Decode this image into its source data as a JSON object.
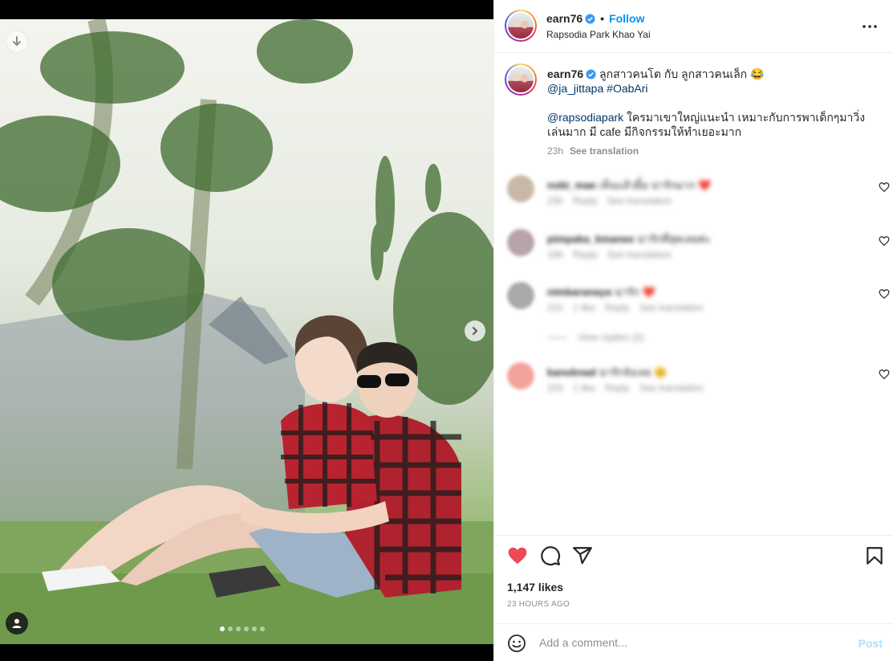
{
  "post": {
    "username": "earn76",
    "follow_label": "Follow",
    "separator": "•",
    "location": "Rapsodia Park Khao Yai"
  },
  "caption": {
    "username": "earn76",
    "line1": "ลูกสาวคนโต กับ ลูกสาวคนเล็ก 😂",
    "mention1": "@ja_jittapa",
    "hashtag": "#OabAri",
    "mention2": "@rapsodiapark",
    "body": "ใครมาเขาใหญ่แนะนำ เหมาะกับการพาเด็กๆมาวิ่งเล่นมาก มี cafe มีกิจกรรมให้ทำเยอะมาก",
    "age": "23h",
    "see_translation": "See translation"
  },
  "comments": [
    {
      "author": "nobi_mae",
      "text": "เห็นแล้วยิ้ม น่ารักมาก ❤️",
      "age": "23h",
      "reply": "Reply",
      "translate": "See translation",
      "avatar_color": "#c9b8a6"
    },
    {
      "author": "pimpaka_kmanee",
      "text": "น่ารักที่สุดเลยค่ะ",
      "age": "19h",
      "reply": "Reply",
      "translate": "See translation",
      "avatar_color": "#b7a3a8"
    },
    {
      "author": "nimbaranaya",
      "text": "น่ารัก ❤️",
      "age": "21h",
      "likes": "1 like",
      "reply": "Reply",
      "translate": "See translation",
      "avatar_color": "#a9a9a9"
    },
    {
      "author": "kanoknad",
      "text": "น่ารักจังเลย 😊",
      "age": "22h",
      "likes": "1 like",
      "reply": "Reply",
      "translate": "See translation",
      "avatar_color": "#f4a39a"
    }
  ],
  "view_replies": "View replies (2)",
  "likes": "1,147 likes",
  "timestamp": "23 HOURS AGO",
  "add_comment": {
    "placeholder": "Add a comment...",
    "post_label": "Post"
  },
  "carousel": {
    "count": 6,
    "active_index": 0
  },
  "colors": {
    "accent": "#0095f6",
    "like_red": "#ed4956",
    "verified": "#3897f0"
  }
}
